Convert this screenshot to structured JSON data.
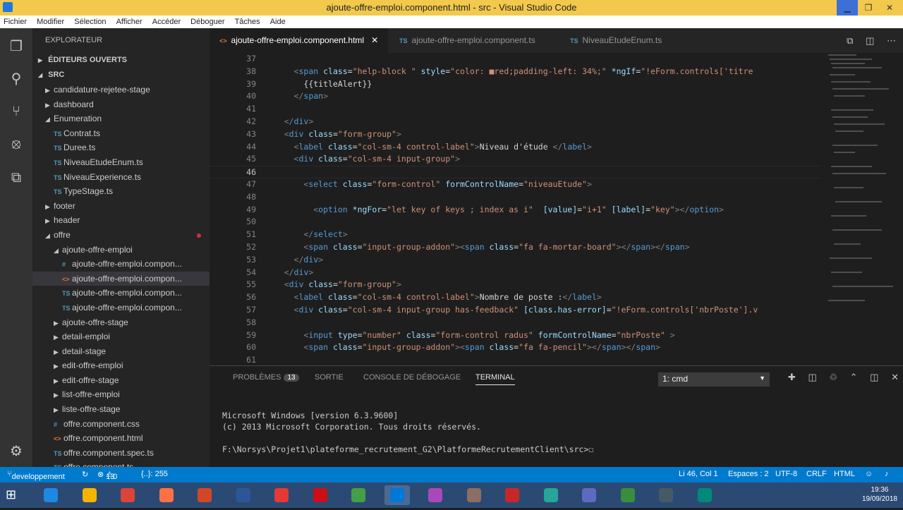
{
  "window": {
    "title": "ajoute-offre-emploi.component.html - src - Visual Studio Code",
    "min": "▁",
    "max": "❐",
    "close": "✕"
  },
  "menu": [
    "Fichier",
    "Modifier",
    "Sélection",
    "Afficher",
    "Accéder",
    "Déboguer",
    "Tâches",
    "Aide"
  ],
  "activity": [
    "files-icon",
    "search-icon",
    "source-control-icon",
    "debug-icon",
    "extensions-icon",
    "settings-icon"
  ],
  "sidebar": {
    "header": "EXPLORATEUR",
    "sections": [
      "ÉDITEURS OUVERTS",
      "SRC"
    ],
    "items": [
      {
        "label": "candidature-rejetee-stage",
        "indent": 1,
        "kind": "folder-closed"
      },
      {
        "label": "dashboard",
        "indent": 1,
        "kind": "folder-closed"
      },
      {
        "label": "Enumeration",
        "indent": 1,
        "kind": "folder-open"
      },
      {
        "label": "Contrat.ts",
        "indent": 2,
        "kind": "ts"
      },
      {
        "label": "Duree.ts",
        "indent": 2,
        "kind": "ts"
      },
      {
        "label": "NiveauEtudeEnum.ts",
        "indent": 2,
        "kind": "ts"
      },
      {
        "label": "NiveauExperience.ts",
        "indent": 2,
        "kind": "ts"
      },
      {
        "label": "TypeStage.ts",
        "indent": 2,
        "kind": "ts"
      },
      {
        "label": "footer",
        "indent": 1,
        "kind": "folder-closed"
      },
      {
        "label": "header",
        "indent": 1,
        "kind": "folder-closed"
      },
      {
        "label": "offre",
        "indent": 1,
        "kind": "folder-open",
        "modified": true
      },
      {
        "label": "ajoute-offre-emploi",
        "indent": 2,
        "kind": "folder-open"
      },
      {
        "label": "ajoute-offre-emploi.compon...",
        "indent": 3,
        "kind": "css"
      },
      {
        "label": "ajoute-offre-emploi.compon...",
        "indent": 3,
        "kind": "html",
        "selected": true
      },
      {
        "label": "ajoute-offre-emploi.compon...",
        "indent": 3,
        "kind": "ts"
      },
      {
        "label": "ajoute-offre-emploi.compon...",
        "indent": 3,
        "kind": "ts"
      },
      {
        "label": "ajoute-offre-stage",
        "indent": 2,
        "kind": "folder-closed"
      },
      {
        "label": "detail-emploi",
        "indent": 2,
        "kind": "folder-closed"
      },
      {
        "label": "detail-stage",
        "indent": 2,
        "kind": "folder-closed"
      },
      {
        "label": "edit-offre-emploi",
        "indent": 2,
        "kind": "folder-closed"
      },
      {
        "label": "edit-offre-stage",
        "indent": 2,
        "kind": "folder-closed"
      },
      {
        "label": "list-offre-emploi",
        "indent": 2,
        "kind": "folder-closed"
      },
      {
        "label": "liste-offre-stage",
        "indent": 2,
        "kind": "folder-closed"
      },
      {
        "label": "offre.component.css",
        "indent": 2,
        "kind": "css"
      },
      {
        "label": "offre.component.html",
        "indent": 2,
        "kind": "html"
      },
      {
        "label": "offre.component.spec.ts",
        "indent": 2,
        "kind": "ts"
      },
      {
        "label": "offre.component.ts",
        "indent": 2,
        "kind": "ts"
      }
    ]
  },
  "tabs": [
    {
      "label": "ajoute-offre-emploi.component.html",
      "kind": "html",
      "active": true,
      "close": "✕"
    },
    {
      "label": "ajoute-offre-emploi.component.ts",
      "kind": "ts",
      "active": false
    },
    {
      "label": "NiveauEtudeEnum.ts",
      "kind": "ts",
      "active": false
    }
  ],
  "icons": {
    "html": "<>",
    "ts": "TS",
    "css": "#",
    "folder-open": "◢",
    "folder-closed": "▶"
  },
  "code": {
    "current_line": 46,
    "lines": [
      {
        "n": 37,
        "tokens": []
      },
      {
        "n": 38,
        "tokens": [
          [
            "t-br",
            "      <"
          ],
          [
            "t-tag",
            "span"
          ],
          [
            "t-attr",
            " class"
          ],
          [
            "t-txt",
            "="
          ],
          [
            "t-str",
            "\"help-block \""
          ],
          [
            "t-attr",
            " style"
          ],
          [
            "t-txt",
            "="
          ],
          [
            "t-str",
            "\"color: ■red;padding-left: 34%;\""
          ],
          [
            "t-attr",
            " *ngIf"
          ],
          [
            "t-txt",
            "="
          ],
          [
            "t-str",
            "\"!eForm.controls['titre"
          ]
        ]
      },
      {
        "n": 39,
        "tokens": [
          [
            "t-txt",
            "        {{titleAlert}}"
          ]
        ]
      },
      {
        "n": 40,
        "tokens": [
          [
            "t-br",
            "      </"
          ],
          [
            "t-tag",
            "span"
          ],
          [
            "t-br",
            ">"
          ]
        ]
      },
      {
        "n": 41,
        "tokens": []
      },
      {
        "n": 42,
        "tokens": [
          [
            "t-br",
            "    </"
          ],
          [
            "t-tag",
            "div"
          ],
          [
            "t-br",
            ">"
          ]
        ]
      },
      {
        "n": 43,
        "tokens": [
          [
            "t-br",
            "    <"
          ],
          [
            "t-tag",
            "div"
          ],
          [
            "t-attr",
            " class"
          ],
          [
            "t-txt",
            "="
          ],
          [
            "t-str",
            "\"form-group\""
          ],
          [
            "t-br",
            ">"
          ]
        ]
      },
      {
        "n": 44,
        "tokens": [
          [
            "t-br",
            "      <"
          ],
          [
            "t-tag",
            "label"
          ],
          [
            "t-attr",
            " class"
          ],
          [
            "t-txt",
            "="
          ],
          [
            "t-str",
            "\"col-sm-4 control-label\""
          ],
          [
            "t-br",
            ">"
          ],
          [
            "t-txt",
            "Niveau d'étude "
          ],
          [
            "t-br",
            "</"
          ],
          [
            "t-tag",
            "label"
          ],
          [
            "t-br",
            ">"
          ]
        ]
      },
      {
        "n": 45,
        "tokens": [
          [
            "t-br",
            "      <"
          ],
          [
            "t-tag",
            "div"
          ],
          [
            "t-attr",
            " class"
          ],
          [
            "t-txt",
            "="
          ],
          [
            "t-str",
            "\"col-sm-4 input-group\""
          ],
          [
            "t-br",
            ">"
          ]
        ]
      },
      {
        "n": 46,
        "tokens": []
      },
      {
        "n": 47,
        "tokens": [
          [
            "t-br",
            "        <"
          ],
          [
            "t-tag",
            "select"
          ],
          [
            "t-attr",
            " class"
          ],
          [
            "t-txt",
            "="
          ],
          [
            "t-str",
            "\"form-control\""
          ],
          [
            "t-attr",
            " formControlName"
          ],
          [
            "t-txt",
            "="
          ],
          [
            "t-str",
            "\"niveauEtude\""
          ],
          [
            "t-br",
            ">"
          ]
        ]
      },
      {
        "n": 48,
        "tokens": []
      },
      {
        "n": 49,
        "tokens": [
          [
            "t-br",
            "          <"
          ],
          [
            "t-tag",
            "option"
          ],
          [
            "t-attr",
            " *ngFor"
          ],
          [
            "t-txt",
            "="
          ],
          [
            "t-str",
            "\"let key of keys ; index as i\""
          ],
          [
            "t-attr",
            "  [value]"
          ],
          [
            "t-txt",
            "="
          ],
          [
            "t-str",
            "\"i+1\""
          ],
          [
            "t-attr",
            " [label]"
          ],
          [
            "t-txt",
            "="
          ],
          [
            "t-str",
            "\"key\""
          ],
          [
            "t-br",
            "></"
          ],
          [
            "t-tag",
            "option"
          ],
          [
            "t-br",
            ">"
          ]
        ]
      },
      {
        "n": 50,
        "tokens": []
      },
      {
        "n": 51,
        "tokens": [
          [
            "t-br",
            "        </"
          ],
          [
            "t-tag",
            "select"
          ],
          [
            "t-br",
            ">"
          ]
        ]
      },
      {
        "n": 52,
        "tokens": [
          [
            "t-br",
            "        <"
          ],
          [
            "t-tag",
            "span"
          ],
          [
            "t-attr",
            " class"
          ],
          [
            "t-txt",
            "="
          ],
          [
            "t-str",
            "\"input-group-addon\""
          ],
          [
            "t-br",
            "><"
          ],
          [
            "t-tag",
            "span"
          ],
          [
            "t-attr",
            " class"
          ],
          [
            "t-txt",
            "="
          ],
          [
            "t-str",
            "\"fa fa-mortar-board\""
          ],
          [
            "t-br",
            "></"
          ],
          [
            "t-tag",
            "span"
          ],
          [
            "t-br",
            "></"
          ],
          [
            "t-tag",
            "span"
          ],
          [
            "t-br",
            ">"
          ]
        ]
      },
      {
        "n": 53,
        "tokens": [
          [
            "t-br",
            "      </"
          ],
          [
            "t-tag",
            "div"
          ],
          [
            "t-br",
            ">"
          ]
        ]
      },
      {
        "n": 54,
        "tokens": [
          [
            "t-br",
            "    </"
          ],
          [
            "t-tag",
            "div"
          ],
          [
            "t-br",
            ">"
          ]
        ]
      },
      {
        "n": 55,
        "tokens": [
          [
            "t-br",
            "    <"
          ],
          [
            "t-tag",
            "div"
          ],
          [
            "t-attr",
            " class"
          ],
          [
            "t-txt",
            "="
          ],
          [
            "t-str",
            "\"form-group\""
          ],
          [
            "t-br",
            ">"
          ]
        ]
      },
      {
        "n": 56,
        "tokens": [
          [
            "t-br",
            "      <"
          ],
          [
            "t-tag",
            "label"
          ],
          [
            "t-attr",
            " class"
          ],
          [
            "t-txt",
            "="
          ],
          [
            "t-str",
            "\"col-sm-4 control-label\""
          ],
          [
            "t-br",
            ">"
          ],
          [
            "t-txt",
            "Nombre de poste :"
          ],
          [
            "t-br",
            "</"
          ],
          [
            "t-tag",
            "label"
          ],
          [
            "t-br",
            ">"
          ]
        ]
      },
      {
        "n": 57,
        "tokens": [
          [
            "t-br",
            "      <"
          ],
          [
            "t-tag",
            "div"
          ],
          [
            "t-attr",
            " class"
          ],
          [
            "t-txt",
            "="
          ],
          [
            "t-str",
            "\"col-sm-4 input-group has-feedback\""
          ],
          [
            "t-attr",
            " [class.has-error]"
          ],
          [
            "t-txt",
            "="
          ],
          [
            "t-str",
            "\"!eForm.controls['nbrPoste'].v"
          ]
        ]
      },
      {
        "n": 58,
        "tokens": []
      },
      {
        "n": 59,
        "tokens": [
          [
            "t-br",
            "        <"
          ],
          [
            "t-tag",
            "input"
          ],
          [
            "t-attr",
            " type"
          ],
          [
            "t-txt",
            "="
          ],
          [
            "t-str",
            "\"number\""
          ],
          [
            "t-attr",
            " class"
          ],
          [
            "t-txt",
            "="
          ],
          [
            "t-str",
            "\"form-control radus\""
          ],
          [
            "t-attr",
            " formControlName"
          ],
          [
            "t-txt",
            "="
          ],
          [
            "t-str",
            "\"nbrPoste\""
          ],
          [
            "t-br",
            " >"
          ]
        ]
      },
      {
        "n": 60,
        "tokens": [
          [
            "t-br",
            "        <"
          ],
          [
            "t-tag",
            "span"
          ],
          [
            "t-attr",
            " class"
          ],
          [
            "t-txt",
            "="
          ],
          [
            "t-str",
            "\"input-group-addon\""
          ],
          [
            "t-br",
            "><"
          ],
          [
            "t-tag",
            "span"
          ],
          [
            "t-attr",
            " class"
          ],
          [
            "t-txt",
            "="
          ],
          [
            "t-str",
            "\"fa fa-pencil\""
          ],
          [
            "t-br",
            "></"
          ],
          [
            "t-tag",
            "span"
          ],
          [
            "t-br",
            "></"
          ],
          [
            "t-tag",
            "span"
          ],
          [
            "t-br",
            ">"
          ]
        ]
      },
      {
        "n": 61,
        "tokens": []
      }
    ]
  },
  "panel": {
    "tabs": [
      {
        "label": "PROBLÈMES",
        "badge": "13"
      },
      {
        "label": "SORTIE"
      },
      {
        "label": "CONSOLE DE DÉBOGAGE"
      },
      {
        "label": "TERMINAL",
        "active": true
      }
    ],
    "terminal_select": "1: cmd",
    "terminal_lines": [
      "Microsoft Windows [version 6.3.9600]",
      "(c) 2013 Microsoft Corporation. Tous droits réservés.",
      "",
      "F:\\Norsys\\Projet1\\plateforme_recrutement_G2\\PlatformeRecrutementClient\\src>☐"
    ]
  },
  "status": {
    "branch": "developpement",
    "errors": "13",
    "warnings": "0",
    "braces": "{..}: 255",
    "position": "Li 46, Col 1",
    "spaces": "Espaces : 2",
    "encoding": "UTF-8",
    "eol": "CRLF",
    "language": "HTML"
  },
  "taskbar": {
    "apps": [
      "ie-icon",
      "explorer-icon",
      "chrome-icon",
      "firefox-icon",
      "powerpoint-icon",
      "word-icon",
      "app-icon",
      "opera-icon",
      "app-icon",
      "vscode-icon",
      "app-icon",
      "app-icon",
      "idea-icon",
      "app-icon",
      "app-icon",
      "app-icon",
      "app-icon",
      "app-icon"
    ],
    "time": "19:36",
    "date": "19/09/2018"
  }
}
